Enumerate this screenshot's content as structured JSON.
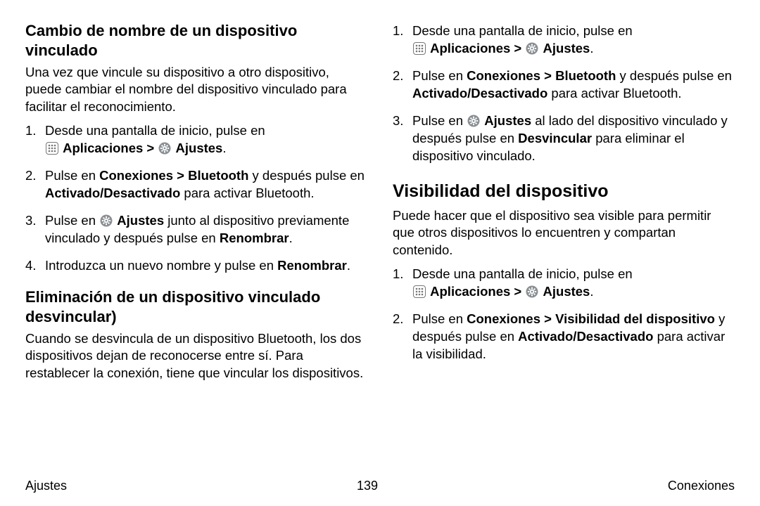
{
  "left": {
    "h1": "Cambio de nombre de un dispositivo vinculado",
    "p1": "Una vez que vincule su dispositivo a otro dispositivo, puede cambiar el nombre del dispositivo vinculado para facilitar el reconocimiento.",
    "s1a": "Desde una pantalla de inicio, pulse en ",
    "s1_apps": "Aplicaciones",
    "chev": " > ",
    "s1_settings": "Ajustes",
    "dot": ".",
    "s2a": "Pulse en ",
    "s2b": "Conexiones > Bluetooth",
    "s2c": " y después pulse en ",
    "s2d": "Activado/Desactivado",
    "s2e": " para activar Bluetooth.",
    "s3a": "Pulse en ",
    "s3b": "Ajustes",
    "s3c": " junto al dispositivo previamente vinculado y después pulse en ",
    "s3d": "Renombrar",
    "s4a": "Introduzca un nuevo nombre y pulse en ",
    "s4b": "Renombrar",
    "h2": "Eliminación de un dispositivo vinculado desvincular)",
    "p2": "Cuando se desvincula de un dispositivo Bluetooth, los dos dispositivos dejan de reconocerse entre sí. Para restablecer la conexión, tiene que vincular los dispositivos."
  },
  "right": {
    "r1a": "Desde una pantalla de inicio, pulse en ",
    "r1_apps": "Aplicaciones",
    "chev": " > ",
    "r1_settings": "Ajustes",
    "dot": ".",
    "r2a": "Pulse en ",
    "r2b": "Conexiones > Bluetooth",
    "r2c": " y después pulse en ",
    "r2d": "Activado/Desactivado",
    "r2e": " para activar Bluetooth.",
    "r3a": "Pulse en ",
    "r3b": "Ajustes",
    "r3c": " al lado del dispositivo vinculado y después pulse en ",
    "r3d": "Desvincular",
    "r3e": " para eliminar el dispositivo vinculado.",
    "h1": "Visibilidad del dispositivo",
    "p1": "Puede hacer que el dispositivo sea visible para permitir que otros dispositivos lo encuentren y compartan contenido.",
    "v1a": "Desde una pantalla de inicio, pulse en ",
    "v1_apps": "Aplicaciones",
    "v1_settings": "Ajustes",
    "v2a": "Pulse en ",
    "v2b": "Conexiones > Visibilidad del dispositivo",
    "v2c": " y después pulse en ",
    "v2d": "Activado/Desactivado",
    "v2e": " para activar la visibilidad."
  },
  "footer": {
    "left": "Ajustes",
    "center": "139",
    "right": "Conexiones"
  }
}
